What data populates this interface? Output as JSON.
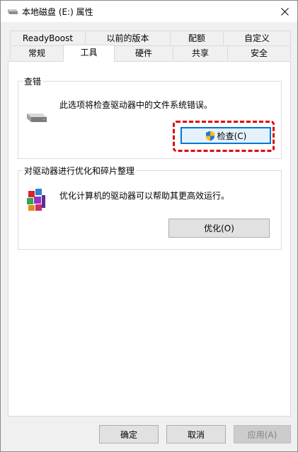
{
  "window": {
    "title": "本地磁盘 (E:) 属性"
  },
  "tabs": {
    "row_top": [
      {
        "label": "ReadyBoost"
      },
      {
        "label": "以前的版本"
      },
      {
        "label": "配额"
      },
      {
        "label": "自定义"
      }
    ],
    "row_bottom": [
      {
        "label": "常规"
      },
      {
        "label": "工具"
      },
      {
        "label": "硬件"
      },
      {
        "label": "共享"
      },
      {
        "label": "安全"
      }
    ],
    "active": "工具"
  },
  "error_check": {
    "title": "查错",
    "description": "此选项将检查驱动器中的文件系统错误。",
    "button_label": "检查(C)",
    "icon": "drive-icon"
  },
  "optimize": {
    "title": "对驱动器进行优化和碎片整理",
    "description": "优化计算机的驱动器可以帮助其更高效运行。",
    "button_label": "优化(O)",
    "icon": "defrag-icon"
  },
  "footer": {
    "ok_label": "确定",
    "cancel_label": "取消",
    "apply_label": "应用(A)"
  },
  "colors": {
    "highlight": "#e00000",
    "focus": "#0078d7"
  }
}
